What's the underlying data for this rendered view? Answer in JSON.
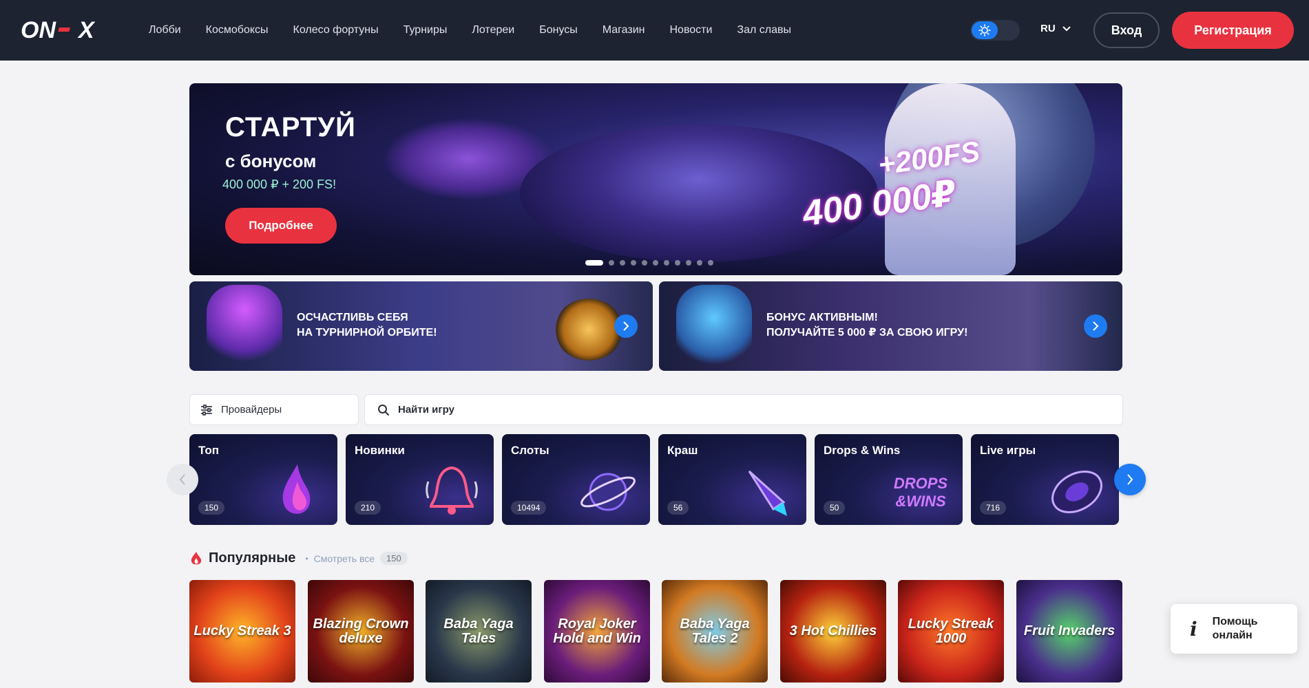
{
  "header": {
    "nav": [
      "Лобби",
      "Космобоксы",
      "Колесо фортуны",
      "Турниры",
      "Лотереи",
      "Бонусы",
      "Магазин",
      "Новости",
      "Зал славы"
    ],
    "lang": "RU",
    "login": "Вход",
    "register": "Регистрация",
    "colors": {
      "bg": "#1d2331",
      "accent": "#e9323f",
      "toggle": "#1e7bf1"
    }
  },
  "hero": {
    "title": "СТАРТУЙ",
    "subtitle": "с бонусом",
    "amount": "400 000 ₽ + 200 FS!",
    "button": "Подробнее",
    "art_fs": "+200FS",
    "art_amount": "400 000₽",
    "slides": 11,
    "active_slide": 1
  },
  "promos": [
    {
      "line1": "Осчастливь себя",
      "line2": "на турнирной орбите!"
    },
    {
      "line1": "Бонус активным!",
      "line2": "Получайте 5 000 ₽ за свою игру!"
    }
  ],
  "filters": {
    "providers": "Провайдеры",
    "search_placeholder": "Найти игру"
  },
  "categories": [
    {
      "name": "Топ",
      "count": "150",
      "icon": "flame-icon"
    },
    {
      "name": "Новинки",
      "count": "210",
      "icon": "bell-icon"
    },
    {
      "name": "Слоты",
      "count": "10494",
      "icon": "planet-icon"
    },
    {
      "name": "Краш",
      "count": "56",
      "icon": "rocket-icon"
    },
    {
      "name": "Drops & Wins",
      "count": "50",
      "icon": "drops-wins-icon"
    },
    {
      "name": "Live игры",
      "count": "716",
      "icon": "roulette-icon"
    }
  ],
  "popular": {
    "title": "Популярные",
    "view_all": "Смотреть все",
    "count": "150",
    "games": [
      {
        "title": "Lucky Streak 3",
        "color": "#e2421a"
      },
      {
        "title": "Blazing Crown deluxe",
        "color": "#7a1212"
      },
      {
        "title": "Baba Yaga Tales",
        "color": "#29374a"
      },
      {
        "title": "Royal Joker Hold and Win",
        "color": "#6b1d7a"
      },
      {
        "title": "Baba Yaga Tales 2",
        "color": "#d27a22"
      },
      {
        "title": "3 Hot Chillies",
        "color": "#b52210"
      },
      {
        "title": "Lucky Streak 1000",
        "color": "#c9241a"
      },
      {
        "title": "Fruit Invaders",
        "color": "#4a2f8c"
      }
    ]
  },
  "help": {
    "line1": "Помощь",
    "line2": "онлайн"
  }
}
